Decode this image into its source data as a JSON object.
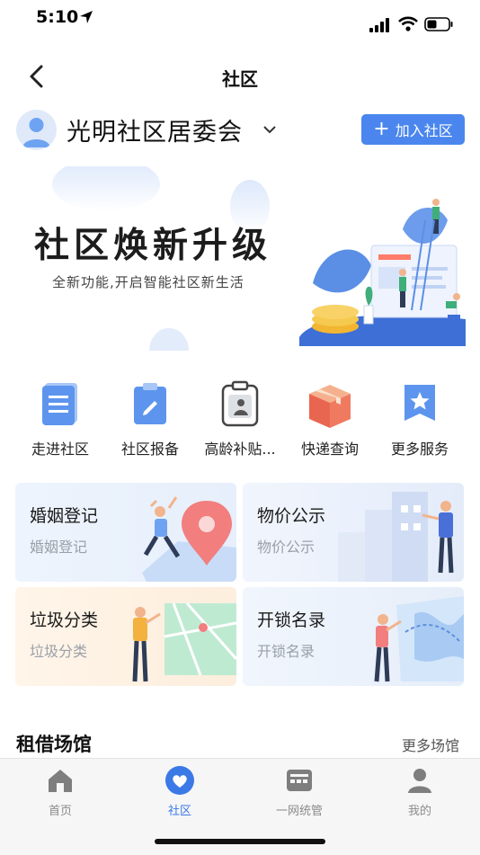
{
  "status_bar": {
    "time": "5:10"
  },
  "nav": {
    "title": "社区"
  },
  "community": {
    "name": "光明社区居委会",
    "join_button": "加入社区"
  },
  "banner": {
    "title": "社区焕新升级",
    "subtitle": "全新功能,开启智能社区新生活"
  },
  "quick_actions": [
    {
      "label": "走进社区",
      "icon": "document-icon"
    },
    {
      "label": "社区报备",
      "icon": "clipboard-edit-icon"
    },
    {
      "label": "高龄补贴...",
      "icon": "id-badge-icon"
    },
    {
      "label": "快递查询",
      "icon": "package-icon"
    },
    {
      "label": "更多服务",
      "icon": "star-bookmark-icon"
    }
  ],
  "services": [
    {
      "title": "婚姻登记",
      "subtitle": "婚姻登记"
    },
    {
      "title": "物价公示",
      "subtitle": "物价公示"
    },
    {
      "title": "垃圾分类",
      "subtitle": "垃圾分类"
    },
    {
      "title": "开锁名录",
      "subtitle": "开锁名录"
    }
  ],
  "rental": {
    "title": "租借场馆",
    "more": "更多场馆"
  },
  "tabbar": {
    "items": [
      {
        "label": "首页",
        "icon": "home-icon",
        "active": false
      },
      {
        "label": "社区",
        "icon": "heart-icon",
        "active": true
      },
      {
        "label": "一网统管",
        "icon": "dashboard-icon",
        "active": false
      },
      {
        "label": "我的",
        "icon": "user-icon",
        "active": false
      }
    ]
  },
  "colors": {
    "accent": "#4a86ee",
    "tab_active": "#3a79e6",
    "tab_inactive": "#8b8b8b"
  }
}
